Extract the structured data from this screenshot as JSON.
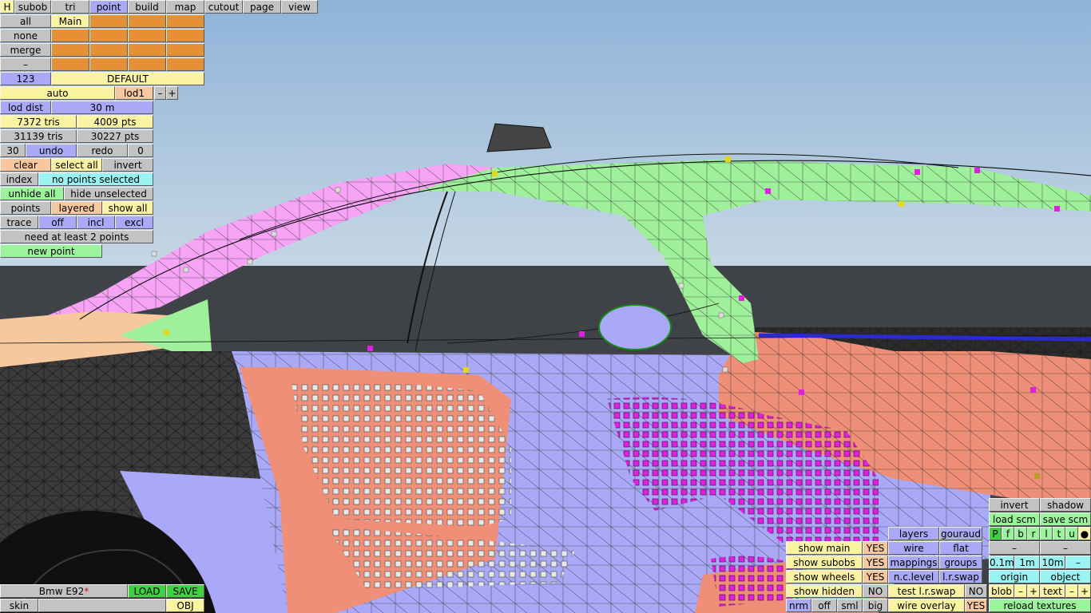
{
  "app": {
    "model_name": "Bmw E92",
    "dirty_mark": "*"
  },
  "top_tabs": [
    {
      "label": "H",
      "active": false
    },
    {
      "label": "subob",
      "active": false
    },
    {
      "label": "tri",
      "active": false
    },
    {
      "label": "point",
      "active": true
    },
    {
      "label": "build",
      "active": false
    },
    {
      "label": "map",
      "active": false
    },
    {
      "label": "cutout",
      "active": false
    },
    {
      "label": "page",
      "active": false
    },
    {
      "label": "view",
      "active": false
    }
  ],
  "subobject": {
    "all": "all",
    "none": "none",
    "merge": "merge",
    "minus": "–",
    "main": "Main",
    "count": "123",
    "material": "DEFAULT"
  },
  "lod": {
    "auto": "auto",
    "level": "lod1",
    "minus": "–",
    "plus": "+",
    "dist_label": "lod dist",
    "dist_value": "30 m"
  },
  "stats": {
    "tris_lod": "7372 tris",
    "pts_lod": "4009 pts",
    "tris_total": "31139 tris",
    "pts_total": "30227 pts"
  },
  "history": {
    "count": "30",
    "undo": "undo",
    "redo": "redo",
    "redo_count": "0"
  },
  "selection": {
    "clear": "clear",
    "select_all": "select all",
    "invert": "invert",
    "index": "index",
    "status": "no points selected",
    "unhide_all": "unhide all",
    "hide_unselected": "hide unselected",
    "points": "points",
    "layered": "layered",
    "show_all": "show all",
    "trace": "trace",
    "off": "off",
    "incl": "incl",
    "excl": "excl",
    "hint": "need at least 2 points",
    "new_point": "new point"
  },
  "bottom_left": {
    "load": "LOAD",
    "save": "SAVE",
    "skin": "skin",
    "obj": "OBJ"
  },
  "display": {
    "show_main": "show main",
    "show_main_val": "YES",
    "show_subobs": "show subobs",
    "show_subobs_val": "YES",
    "show_wheels": "show wheels",
    "show_wheels_val": "YES",
    "show_hidden": "show hidden",
    "show_hidden_val": "NO",
    "nrm": "nrm",
    "off": "off",
    "sml": "sml",
    "big": "big",
    "layers": "layers",
    "gouraud": "gouraud",
    "wire": "wire",
    "flat": "flat",
    "mappings": "mappings",
    "groups": "groups",
    "nc_level": "n.c.level",
    "lr_swap": "l.r.swap",
    "test_lr_swap": "test l.r.swap",
    "test_lr_swap_val": "NO",
    "wire_overlay": "wire overlay",
    "wire_overlay_val": "YES"
  },
  "right_panel": {
    "invert": "invert",
    "shadow": "shadow",
    "load_scm": "load scm",
    "save_scm": "save scm",
    "toggles": [
      "P",
      "f",
      "b",
      "r",
      "l",
      "t",
      "u",
      "●"
    ],
    "minus_a": "–",
    "minus_b": "–",
    "grid_01": "0.1m",
    "grid_1": "1m",
    "grid_10": "10m",
    "grid_minus": "–",
    "origin": "origin",
    "object": "object",
    "blob": "blob",
    "blob_minus": "–",
    "blob_plus": "+",
    "text": "text",
    "text_minus": "–",
    "text_plus": "+",
    "reload_textures": "reload textures"
  },
  "colors": {
    "active_tab": "#a9a9f7",
    "button_grey": "#c3c3c3",
    "yellow": "#f9f3a2",
    "green": "#3ed140",
    "light_green": "#9bf49b",
    "cyan": "#99f3f3",
    "orange": "#e59035",
    "peach": "#f7c89e",
    "sky": "#a9c4dc",
    "mesh_salmon": "#ef8f77",
    "mesh_periwinkle": "#a9a9f7",
    "mesh_mint": "#9ef09a",
    "mesh_pink": "#f7a4f7",
    "point_magenta": "#e020e0"
  }
}
